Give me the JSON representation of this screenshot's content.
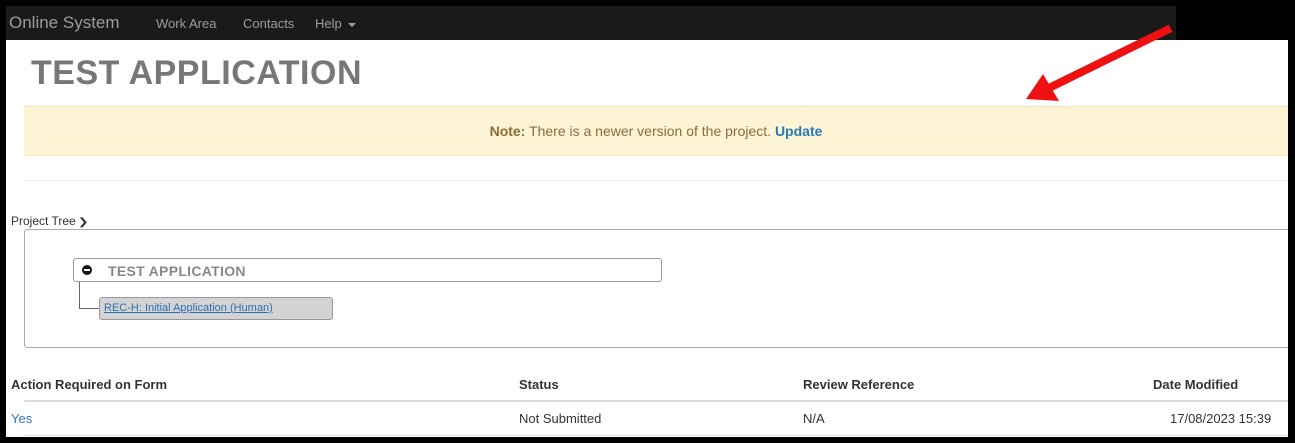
{
  "navbar": {
    "brand": "Online System",
    "items": [
      {
        "label": "Work Area"
      },
      {
        "label": "Contacts"
      },
      {
        "label": "Help"
      }
    ]
  },
  "page": {
    "title": "TEST APPLICATION"
  },
  "alert": {
    "prefix": "Note:",
    "message": " There is a newer version of the project. ",
    "link": "Update"
  },
  "project_tree": {
    "label": "Project Tree",
    "root": "TEST APPLICATION",
    "child": "REC-H: Initial Application (Human)"
  },
  "table": {
    "headers": [
      "Action Required on Form",
      "Status",
      "Review Reference",
      "Date Modified"
    ],
    "rows": [
      [
        "Yes",
        "Not Submitted",
        "N/A",
        "17/08/2023 15:39"
      ]
    ]
  },
  "annotation": {
    "arrow_color": "#ee1111"
  },
  "icons": {
    "caret": "chevron-down-icon",
    "tree_toggle": "chevron-down-icon",
    "collapse": "minus-circle-icon"
  }
}
